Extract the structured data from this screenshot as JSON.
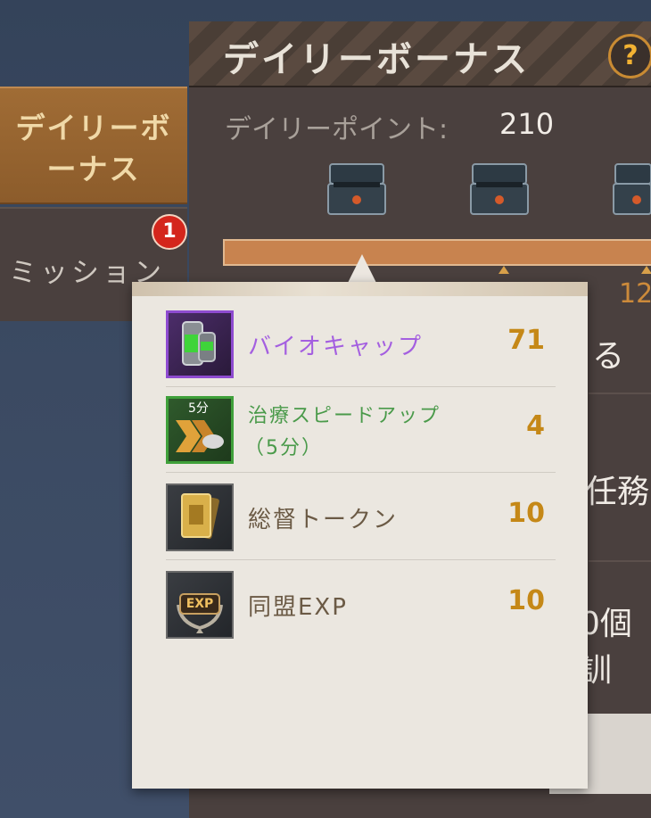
{
  "header": {
    "title": "デイリーボーナス",
    "help_symbol": "?"
  },
  "tabs": [
    {
      "label": "デイリーボーナス",
      "active": true
    },
    {
      "label": "ミッション",
      "badge": "1"
    }
  ],
  "points": {
    "label": "デイリーポイント:",
    "value": "210"
  },
  "progress": {
    "fraction": 1.0,
    "visible_milestone_fragment": "12"
  },
  "background_fragments": {
    "text1": "る",
    "text2": "任務",
    "text3": "0個訓"
  },
  "popup": {
    "items": [
      {
        "name": "バイオキャップ",
        "qty": "71",
        "icon": "bio-cap-icon",
        "frame_color": "#8e4bd0",
        "name_color": "#a45fe0"
      },
      {
        "name_line1": "治療スピードアップ",
        "name_line2": "（5分）",
        "icon_label": "5分",
        "qty": "4",
        "icon": "heal-speedup-icon",
        "frame_color": "#3fa03a",
        "name_color": "#4a9a4a"
      },
      {
        "name": "総督トークン",
        "qty": "10",
        "icon": "governor-token-icon",
        "frame_color": "#5a5a5a",
        "name_color": "#6b5a45"
      },
      {
        "name": "同盟EXP",
        "qty": "10",
        "icon_label": "EXP",
        "icon": "alliance-exp-icon",
        "frame_color": "#5a5a5a",
        "name_color": "#6b5a45"
      }
    ]
  },
  "colors": {
    "accent": "#c58817",
    "tab_active": "#a06c35",
    "badge": "#d4261c"
  }
}
